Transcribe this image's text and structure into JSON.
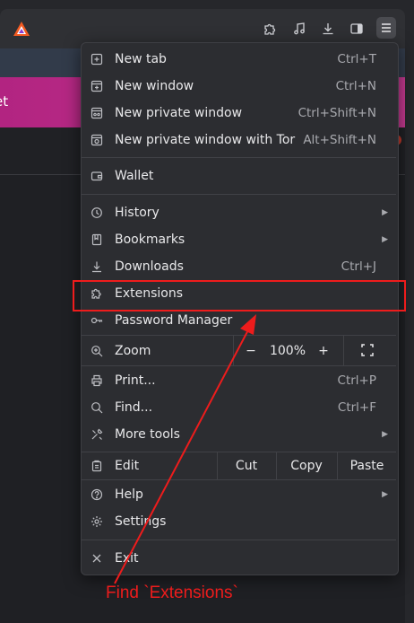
{
  "banner": {
    "text": "et"
  },
  "menu": {
    "items": {
      "new_tab": {
        "label": "New tab",
        "shortcut": "Ctrl+T",
        "icon": "new-tab-icon"
      },
      "new_window": {
        "label": "New window",
        "shortcut": "Ctrl+N",
        "icon": "new-window-icon"
      },
      "new_private": {
        "label": "New private window",
        "shortcut": "Ctrl+Shift+N",
        "icon": "private-window-icon"
      },
      "new_tor": {
        "label": "New private window with Tor",
        "shortcut": "Alt+Shift+N",
        "icon": "tor-window-icon"
      },
      "wallet": {
        "label": "Wallet",
        "icon": "wallet-icon"
      },
      "history": {
        "label": "History",
        "icon": "history-icon"
      },
      "bookmarks": {
        "label": "Bookmarks",
        "icon": "bookmarks-icon"
      },
      "downloads": {
        "label": "Downloads",
        "shortcut": "Ctrl+J",
        "icon": "download-icon"
      },
      "extensions": {
        "label": "Extensions",
        "icon": "puzzle-icon"
      },
      "password_manager": {
        "label": "Password Manager",
        "icon": "key-icon"
      },
      "zoom": {
        "label": "Zoom",
        "minus": "−",
        "value": "100%",
        "plus": "+",
        "icon": "zoom-icon"
      },
      "print": {
        "label": "Print...",
        "shortcut": "Ctrl+P",
        "icon": "print-icon"
      },
      "find": {
        "label": "Find...",
        "shortcut": "Ctrl+F",
        "icon": "search-icon"
      },
      "more_tools": {
        "label": "More tools",
        "icon": "tools-icon"
      },
      "edit": {
        "label": "Edit",
        "cut": "Cut",
        "copy": "Copy",
        "paste": "Paste",
        "icon": "clipboard-icon"
      },
      "help": {
        "label": "Help",
        "icon": "help-icon"
      },
      "settings": {
        "label": "Settings",
        "icon": "gear-icon"
      },
      "exit": {
        "label": "Exit",
        "icon": "close-icon"
      }
    }
  },
  "annotation": {
    "text": "Find `Extensions`",
    "color": "#ee1c1c"
  },
  "colors": {
    "menu_bg": "#2c2d31",
    "banner": "#c3398f"
  }
}
